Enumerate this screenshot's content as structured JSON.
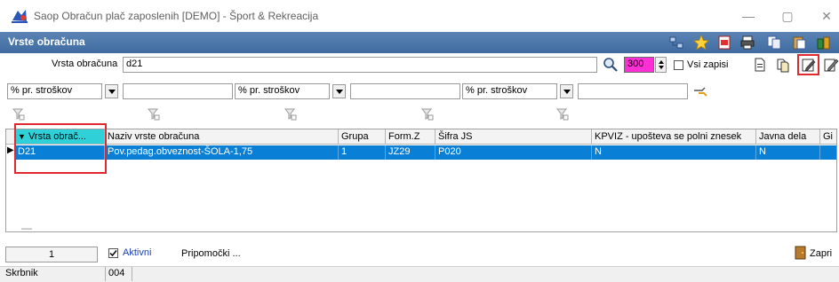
{
  "window": {
    "title": "Saop Obračun plač zaposlenih [DEMO] - Šport & Rekreacija",
    "minimize_glyph": "—",
    "maximize_glyph": "▢",
    "close_glyph": "✕"
  },
  "panel": {
    "title": "Vrste obračuna"
  },
  "search": {
    "label": "Vrsta obračuna",
    "value": "d21",
    "count": "300",
    "all_records_label": "Vsi zapisi",
    "all_records_checked": false
  },
  "filters": [
    {
      "combo": "% pr. stroškov",
      "value": ""
    },
    {
      "combo": "% pr. stroškov",
      "value": ""
    },
    {
      "combo": "% pr. stroškov",
      "value": ""
    }
  ],
  "grid": {
    "columns": [
      "Vrsta obrač...",
      "Naziv vrste obračuna",
      "Grupa",
      "Form.Z",
      "Šifra JS",
      "KPVIZ - upošteva se polni znesek",
      "Javna dela",
      "Gi"
    ],
    "rows": [
      [
        "D21",
        "Pov.pedag.obveznost-ŠOLA-1,75",
        "1",
        "JZ29",
        "P020",
        "N",
        "N",
        ""
      ]
    ],
    "sort_indicator": "▼",
    "row_indicator": "▶"
  },
  "footer": {
    "page": "1",
    "active_label": "Aktivni",
    "active_checked": true,
    "tools_label": "Pripomočki ...",
    "close_label": "Zapri",
    "dash": "—"
  },
  "status": {
    "label": "Skrbnik",
    "value": "004"
  },
  "colors": {
    "header_bg": "#4a76aa",
    "selected_row": "#0a7fd6",
    "sort_column": "#2fd0d8",
    "highlight_box": "#e0282e"
  }
}
